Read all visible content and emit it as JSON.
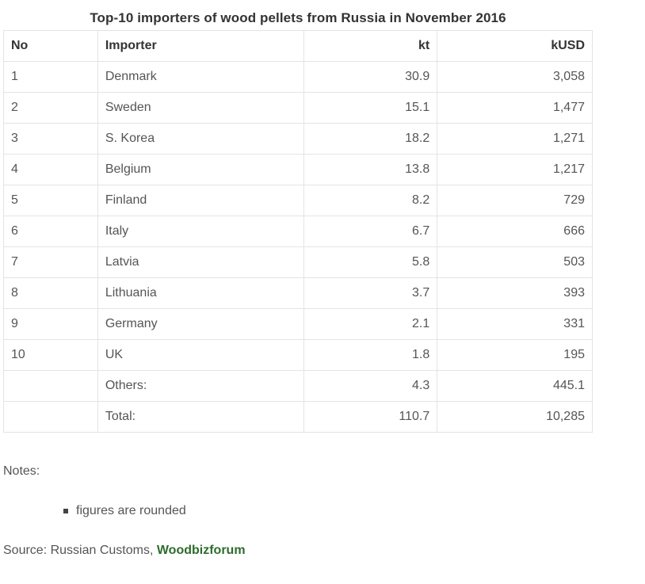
{
  "title": "Top-10 importers of wood pellets from Russia in November 2016",
  "table": {
    "headers": [
      "No",
      "Importer",
      "kt",
      "kUSD"
    ],
    "rows": [
      [
        "1",
        "Denmark",
        "30.9",
        "3,058"
      ],
      [
        "2",
        "Sweden",
        "15.1",
        "1,477"
      ],
      [
        "3",
        "S. Korea",
        "18.2",
        "1,271"
      ],
      [
        "4",
        "Belgium",
        "13.8",
        "1,217"
      ],
      [
        "5",
        "Finland",
        "8.2",
        "729"
      ],
      [
        "6",
        "Italy",
        "6.7",
        "666"
      ],
      [
        "7",
        "Latvia",
        "5.8",
        "503"
      ],
      [
        "8",
        "Lithuania",
        "3.7",
        "393"
      ],
      [
        "9",
        "Germany",
        "2.1",
        "331"
      ],
      [
        "10",
        "UK",
        "1.8",
        "195"
      ],
      [
        "",
        "Others:",
        "4.3",
        "445.1"
      ],
      [
        "",
        "Total:",
        "110.7",
        "10,285"
      ]
    ]
  },
  "notes": {
    "label": "Notes:",
    "items": [
      "figures are rounded"
    ]
  },
  "source": {
    "prefix": "Source: Russian Customs, ",
    "link_text": "Woodbizforum",
    "link_color": "#2e6b2e"
  }
}
